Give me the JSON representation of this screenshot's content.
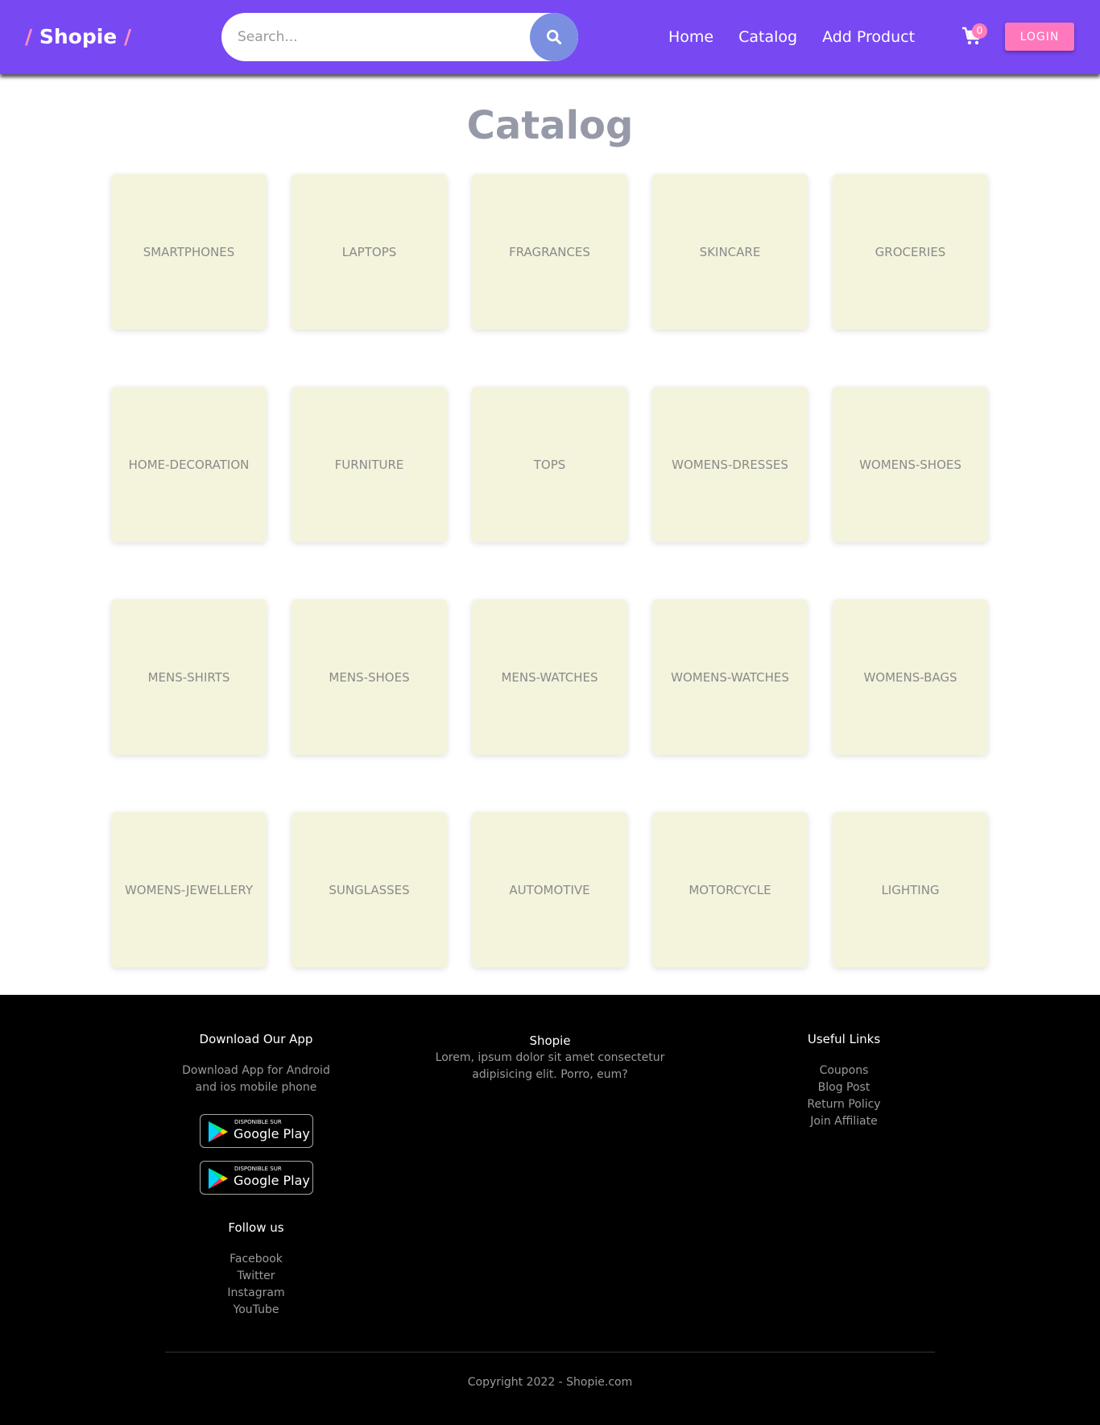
{
  "navbar": {
    "logo": {
      "prefix": "/",
      "name": "Shopie",
      "suffix": "/"
    },
    "search": {
      "placeholder": "Search..."
    },
    "links": [
      "Home",
      "Catalog",
      "Add Product"
    ],
    "cart_count": "0",
    "login_label": "LOGIN"
  },
  "main": {
    "title": "Catalog",
    "categories": [
      "SMARTPHONES",
      "LAPTOPS",
      "FRAGRANCES",
      "SKINCARE",
      "GROCERIES",
      "HOME-DECORATION",
      "FURNITURE",
      "TOPS",
      "WOMENS-DRESSES",
      "WOMENS-SHOES",
      "MENS-SHIRTS",
      "MENS-SHOES",
      "MENS-WATCHES",
      "WOMENS-WATCHES",
      "WOMENS-BAGS",
      "WOMENS-JEWELLERY",
      "SUNGLASSES",
      "AUTOMOTIVE",
      "MOTORCYCLE",
      "LIGHTING"
    ]
  },
  "footer": {
    "download": {
      "heading": "Download Our App",
      "text_line1": "Download App for Android",
      "text_line2": "and ios mobile phone",
      "badge_small": "DISPONIBLE SUR",
      "badge_big": "Google Play"
    },
    "follow": {
      "heading": "Follow us",
      "links": [
        "Facebook",
        "Twitter",
        "Instagram",
        "YouTube"
      ]
    },
    "about": {
      "heading": "Shopie",
      "text_line1": "Lorem, ipsum dolor sit amet consectetur",
      "text_line2": "adipisicing elit. Porro, eum?"
    },
    "useful": {
      "heading": "Useful Links",
      "links": [
        "Coupons",
        "Blog Post",
        "Return Policy",
        "Join Affiliate"
      ]
    },
    "copyright": "Copyright 2022 - Shopie.com"
  },
  "colors": {
    "navbar": "#7848f3",
    "accent_pink": "#ff77bd",
    "search_button": "#7a8fe0",
    "card_bg": "#f4f4dd",
    "title_gray": "#969aa8",
    "footer_bg": "#000000"
  },
  "icons": {
    "search": "search-icon",
    "cart": "cart-icon",
    "google_play": "google-play-icon"
  }
}
